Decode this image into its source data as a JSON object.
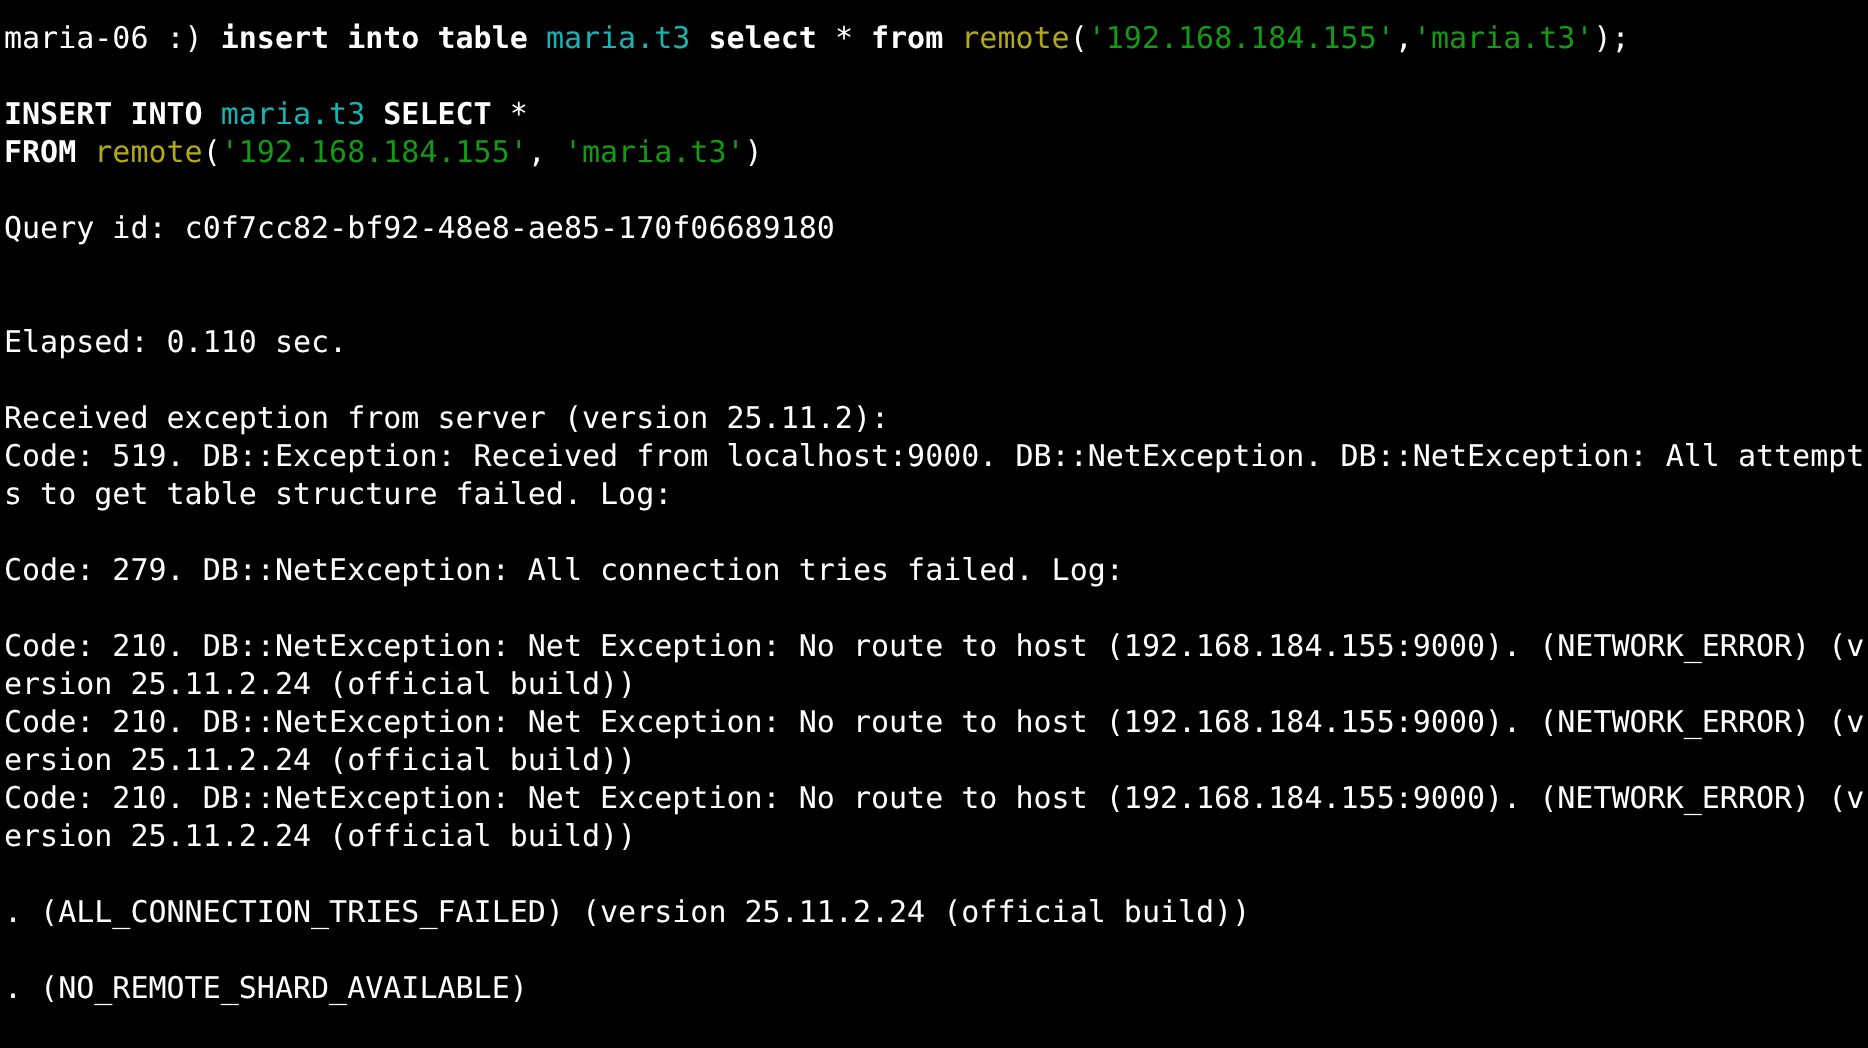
{
  "terminal": {
    "blocks": [
      {
        "kind": "single_gap",
        "lines": [
          [
            {
              "kind": "plain",
              "text": "maria-06 :) "
            },
            {
              "kind": "keyword",
              "text": "insert into table "
            },
            {
              "kind": "ident",
              "text": "maria.t3"
            },
            {
              "kind": "keyword",
              "text": " select "
            },
            {
              "kind": "plain",
              "text": "* "
            },
            {
              "kind": "keyword",
              "text": "from "
            },
            {
              "kind": "func",
              "text": "remote"
            },
            {
              "kind": "plain",
              "text": "("
            },
            {
              "kind": "string",
              "text": "'192.168.184.155'"
            },
            {
              "kind": "plain",
              "text": ","
            },
            {
              "kind": "string",
              "text": "'maria.t3'"
            },
            {
              "kind": "plain",
              "text": ");"
            }
          ]
        ]
      },
      {
        "kind": "single_gap",
        "lines": [
          [
            {
              "kind": "keyword",
              "text": "INSERT INTO "
            },
            {
              "kind": "ident",
              "text": "maria.t3"
            },
            {
              "kind": "keyword",
              "text": " SELECT "
            },
            {
              "kind": "plain",
              "text": "*"
            }
          ],
          [
            {
              "kind": "keyword",
              "text": "FROM "
            },
            {
              "kind": "func",
              "text": "remote"
            },
            {
              "kind": "plain",
              "text": "("
            },
            {
              "kind": "string",
              "text": "'192.168.184.155'"
            },
            {
              "kind": "plain",
              "text": ", "
            },
            {
              "kind": "string",
              "text": "'maria.t3'"
            },
            {
              "kind": "plain",
              "text": ")"
            }
          ]
        ]
      },
      {
        "kind": "single_gap",
        "lines": [
          [
            {
              "kind": "plain",
              "text": "Query id: c0f7cc82-bf92-48e8-ae85-170f06689180"
            }
          ]
        ]
      },
      {
        "kind": "double_gap",
        "lines": [
          [
            {
              "kind": "plain",
              "text": "Elapsed: 0.110 sec."
            }
          ]
        ]
      },
      {
        "kind": "single_gap",
        "lines": [
          [
            {
              "kind": "plain",
              "text": "Received exception from server (version 25.11.2):"
            }
          ],
          [
            {
              "kind": "plain",
              "text": "Code: 519. DB::Exception: Received from localhost:9000. DB::NetException. DB::NetException: All attempt"
            }
          ],
          [
            {
              "kind": "plain",
              "text": "s to get table structure failed. Log:"
            }
          ]
        ]
      },
      {
        "kind": "single_gap",
        "lines": [
          [
            {
              "kind": "plain",
              "text": "Code: 279. DB::NetException: All connection tries failed. Log:"
            }
          ]
        ]
      },
      {
        "kind": "single_gap",
        "lines": [
          [
            {
              "kind": "plain",
              "text": "Code: 210. DB::NetException: Net Exception: No route to host (192.168.184.155:9000). (NETWORK_ERROR) (v"
            }
          ],
          [
            {
              "kind": "plain",
              "text": "ersion 25.11.2.24 (official build))"
            }
          ],
          [
            {
              "kind": "plain",
              "text": "Code: 210. DB::NetException: Net Exception: No route to host (192.168.184.155:9000). (NETWORK_ERROR) (v"
            }
          ],
          [
            {
              "kind": "plain",
              "text": "ersion 25.11.2.24 (official build))"
            }
          ],
          [
            {
              "kind": "plain",
              "text": "Code: 210. DB::NetException: Net Exception: No route to host (192.168.184.155:9000). (NETWORK_ERROR) (v"
            }
          ],
          [
            {
              "kind": "plain",
              "text": "ersion 25.11.2.24 (official build))"
            }
          ]
        ]
      },
      {
        "kind": "single_gap",
        "lines": [
          [
            {
              "kind": "plain",
              "text": ". (ALL_CONNECTION_TRIES_FAILED) (version 25.11.2.24 (official build))"
            }
          ]
        ]
      },
      {
        "kind": "single_gap",
        "lines": [
          [
            {
              "kind": "plain",
              "text": ". (NO_REMOTE_SHARD_AVAILABLE)"
            }
          ]
        ]
      }
    ]
  }
}
